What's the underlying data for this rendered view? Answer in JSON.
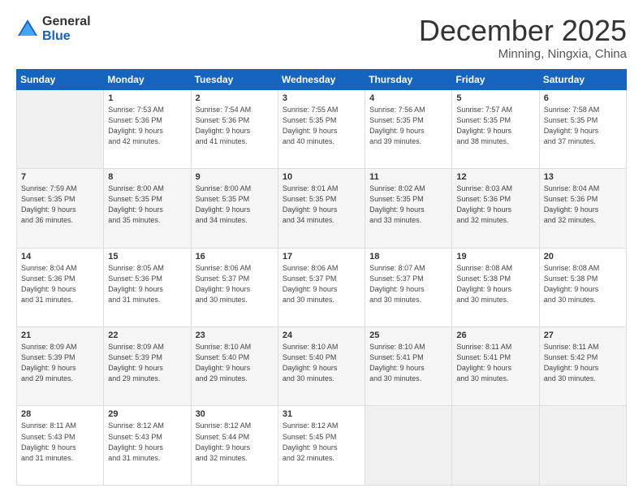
{
  "logo": {
    "general": "General",
    "blue": "Blue"
  },
  "header": {
    "month": "December 2025",
    "location": "Minning, Ningxia, China"
  },
  "days_of_week": [
    "Sunday",
    "Monday",
    "Tuesday",
    "Wednesday",
    "Thursday",
    "Friday",
    "Saturday"
  ],
  "weeks": [
    [
      {
        "day": "",
        "info": ""
      },
      {
        "day": "1",
        "info": "Sunrise: 7:53 AM\nSunset: 5:36 PM\nDaylight: 9 hours\nand 42 minutes."
      },
      {
        "day": "2",
        "info": "Sunrise: 7:54 AM\nSunset: 5:36 PM\nDaylight: 9 hours\nand 41 minutes."
      },
      {
        "day": "3",
        "info": "Sunrise: 7:55 AM\nSunset: 5:35 PM\nDaylight: 9 hours\nand 40 minutes."
      },
      {
        "day": "4",
        "info": "Sunrise: 7:56 AM\nSunset: 5:35 PM\nDaylight: 9 hours\nand 39 minutes."
      },
      {
        "day": "5",
        "info": "Sunrise: 7:57 AM\nSunset: 5:35 PM\nDaylight: 9 hours\nand 38 minutes."
      },
      {
        "day": "6",
        "info": "Sunrise: 7:58 AM\nSunset: 5:35 PM\nDaylight: 9 hours\nand 37 minutes."
      }
    ],
    [
      {
        "day": "7",
        "info": "Sunrise: 7:59 AM\nSunset: 5:35 PM\nDaylight: 9 hours\nand 36 minutes."
      },
      {
        "day": "8",
        "info": "Sunrise: 8:00 AM\nSunset: 5:35 PM\nDaylight: 9 hours\nand 35 minutes."
      },
      {
        "day": "9",
        "info": "Sunrise: 8:00 AM\nSunset: 5:35 PM\nDaylight: 9 hours\nand 34 minutes."
      },
      {
        "day": "10",
        "info": "Sunrise: 8:01 AM\nSunset: 5:35 PM\nDaylight: 9 hours\nand 34 minutes."
      },
      {
        "day": "11",
        "info": "Sunrise: 8:02 AM\nSunset: 5:35 PM\nDaylight: 9 hours\nand 33 minutes."
      },
      {
        "day": "12",
        "info": "Sunrise: 8:03 AM\nSunset: 5:36 PM\nDaylight: 9 hours\nand 32 minutes."
      },
      {
        "day": "13",
        "info": "Sunrise: 8:04 AM\nSunset: 5:36 PM\nDaylight: 9 hours\nand 32 minutes."
      }
    ],
    [
      {
        "day": "14",
        "info": "Sunrise: 8:04 AM\nSunset: 5:36 PM\nDaylight: 9 hours\nand 31 minutes."
      },
      {
        "day": "15",
        "info": "Sunrise: 8:05 AM\nSunset: 5:36 PM\nDaylight: 9 hours\nand 31 minutes."
      },
      {
        "day": "16",
        "info": "Sunrise: 8:06 AM\nSunset: 5:37 PM\nDaylight: 9 hours\nand 30 minutes."
      },
      {
        "day": "17",
        "info": "Sunrise: 8:06 AM\nSunset: 5:37 PM\nDaylight: 9 hours\nand 30 minutes."
      },
      {
        "day": "18",
        "info": "Sunrise: 8:07 AM\nSunset: 5:37 PM\nDaylight: 9 hours\nand 30 minutes."
      },
      {
        "day": "19",
        "info": "Sunrise: 8:08 AM\nSunset: 5:38 PM\nDaylight: 9 hours\nand 30 minutes."
      },
      {
        "day": "20",
        "info": "Sunrise: 8:08 AM\nSunset: 5:38 PM\nDaylight: 9 hours\nand 30 minutes."
      }
    ],
    [
      {
        "day": "21",
        "info": "Sunrise: 8:09 AM\nSunset: 5:39 PM\nDaylight: 9 hours\nand 29 minutes."
      },
      {
        "day": "22",
        "info": "Sunrise: 8:09 AM\nSunset: 5:39 PM\nDaylight: 9 hours\nand 29 minutes."
      },
      {
        "day": "23",
        "info": "Sunrise: 8:10 AM\nSunset: 5:40 PM\nDaylight: 9 hours\nand 29 minutes."
      },
      {
        "day": "24",
        "info": "Sunrise: 8:10 AM\nSunset: 5:40 PM\nDaylight: 9 hours\nand 30 minutes."
      },
      {
        "day": "25",
        "info": "Sunrise: 8:10 AM\nSunset: 5:41 PM\nDaylight: 9 hours\nand 30 minutes."
      },
      {
        "day": "26",
        "info": "Sunrise: 8:11 AM\nSunset: 5:41 PM\nDaylight: 9 hours\nand 30 minutes."
      },
      {
        "day": "27",
        "info": "Sunrise: 8:11 AM\nSunset: 5:42 PM\nDaylight: 9 hours\nand 30 minutes."
      }
    ],
    [
      {
        "day": "28",
        "info": "Sunrise: 8:11 AM\nSunset: 5:43 PM\nDaylight: 9 hours\nand 31 minutes."
      },
      {
        "day": "29",
        "info": "Sunrise: 8:12 AM\nSunset: 5:43 PM\nDaylight: 9 hours\nand 31 minutes."
      },
      {
        "day": "30",
        "info": "Sunrise: 8:12 AM\nSunset: 5:44 PM\nDaylight: 9 hours\nand 32 minutes."
      },
      {
        "day": "31",
        "info": "Sunrise: 8:12 AM\nSunset: 5:45 PM\nDaylight: 9 hours\nand 32 minutes."
      },
      {
        "day": "",
        "info": ""
      },
      {
        "day": "",
        "info": ""
      },
      {
        "day": "",
        "info": ""
      }
    ]
  ]
}
